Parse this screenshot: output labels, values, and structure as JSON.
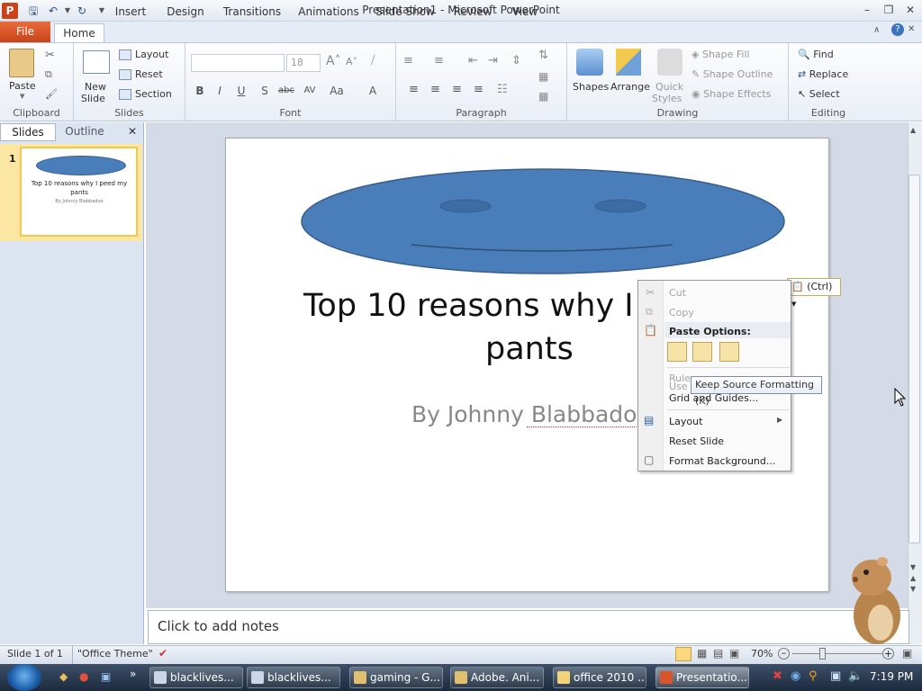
{
  "app": {
    "title": "Presentation1 - Microsoft PowerPoint",
    "icon_letter": "P"
  },
  "ribbon_tabs": [
    "File",
    "Home",
    "Insert",
    "Design",
    "Transitions",
    "Animations",
    "Slide Show",
    "Review",
    "View"
  ],
  "ribbon": {
    "clipboard": {
      "paste": "Paste",
      "label": "Clipboard"
    },
    "slides": {
      "new_slide_1": "New",
      "new_slide_2": "Slide",
      "layout": "Layout",
      "reset": "Reset",
      "section": "Section",
      "label": "Slides"
    },
    "font": {
      "size": "18",
      "label": "Font"
    },
    "paragraph": {
      "label": "Paragraph"
    },
    "drawing": {
      "shapes": "Shapes",
      "arrange": "Arrange",
      "quick_1": "Quick",
      "quick_2": "Styles",
      "shape_fill": "Shape Fill",
      "shape_outline": "Shape Outline",
      "shape_effects": "Shape Effects",
      "label": "Drawing"
    },
    "editing": {
      "find": "Find",
      "replace": "Replace",
      "select": "Select",
      "label": "Editing"
    }
  },
  "left_pane": {
    "tabs": [
      "Slides",
      "Outline"
    ],
    "thumbnail": {
      "number": "1",
      "title": "Top 10 reasons why I peed my pants",
      "subtitle": "By Johnny Blabbadoo"
    }
  },
  "slide": {
    "title_line1": "Top 10 reasons why I p",
    "title_line2": "pants",
    "subtitle": "By Johnny Blabbadoo"
  },
  "notes_placeholder": "Click to add notes",
  "context_menu": {
    "cut": "Cut",
    "copy": "Copy",
    "paste_options": "Paste Options:",
    "ruler": "Ruler",
    "use": "Use",
    "grid": "Grid and Guides...",
    "layout": "Layout",
    "reset_slide": "Reset Slide",
    "format_background": "Format Background..."
  },
  "paste_ctrl": "(Ctrl)",
  "tooltip": "Keep Source Formatting (K)",
  "status": {
    "slide_of": "Slide 1 of 1",
    "theme": "\"Office Theme\"",
    "zoom": "70%"
  },
  "taskbar": {
    "items": [
      "blacklives...",
      "blacklives...",
      "gaming - G...",
      "Adobe. Ani...",
      "office 2010 ...",
      "Presentatio..."
    ],
    "time": "7:19 PM"
  },
  "colors": {
    "accent": "#4f81bd",
    "file_tab": "#d9542b",
    "shape_fill": "#4a7ebb"
  }
}
